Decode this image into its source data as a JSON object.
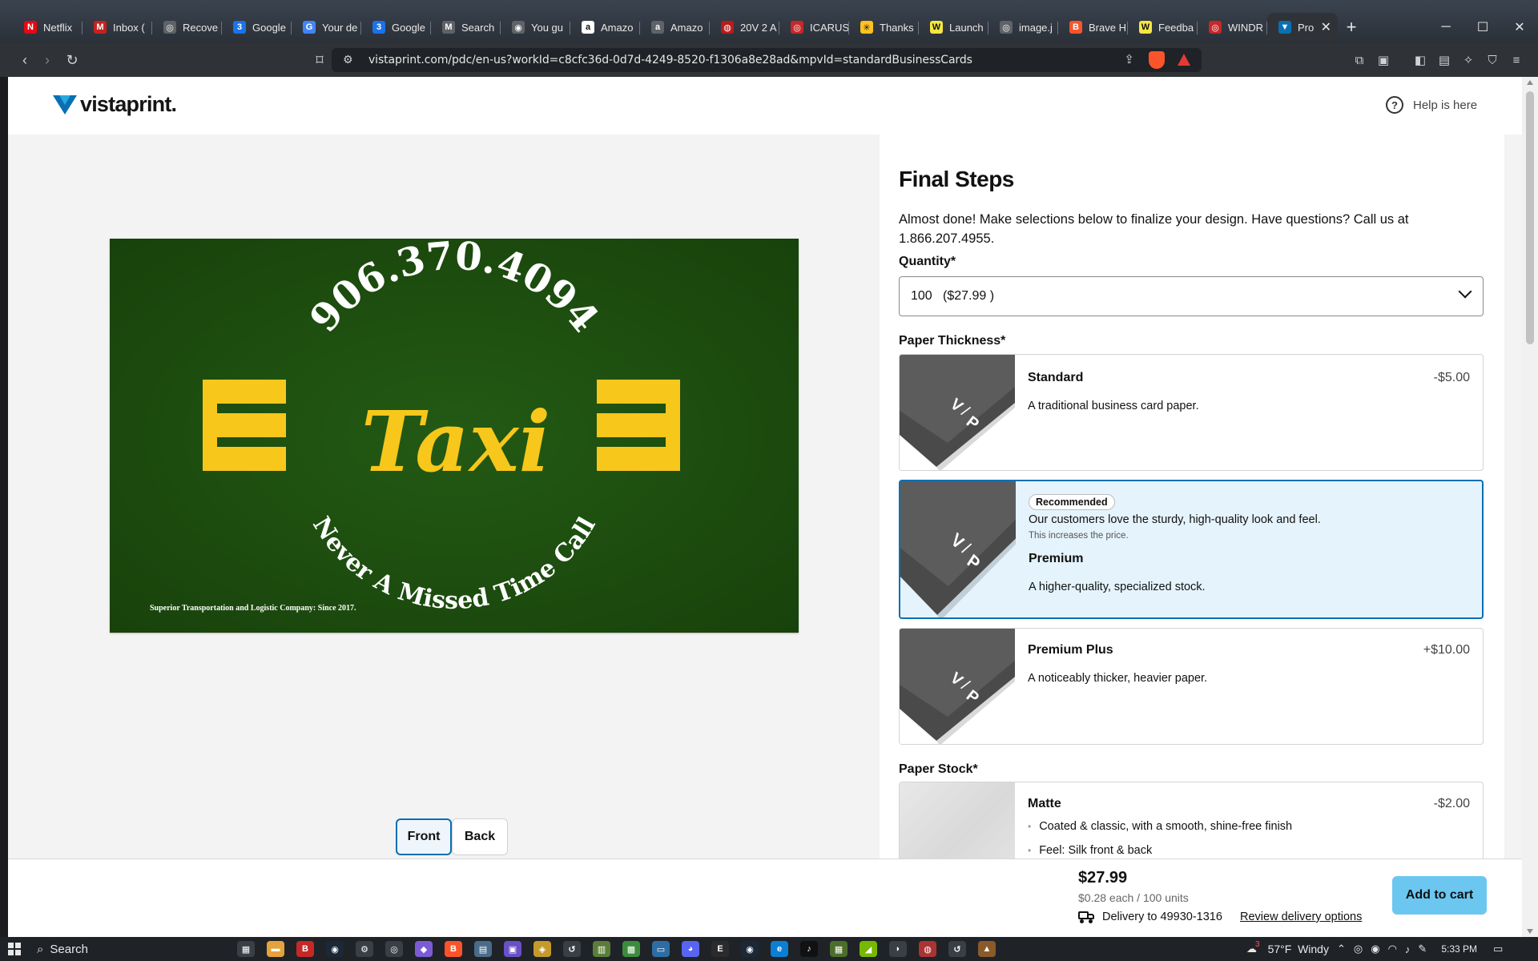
{
  "browser": {
    "tabs": [
      {
        "label": "Netflix",
        "icon": "netflix-icon",
        "color": "#e50914",
        "glyph": "N"
      },
      {
        "label": "Inbox (",
        "icon": "gmail-icon",
        "color": "#c5221f",
        "glyph": "M"
      },
      {
        "label": "Recove",
        "icon": "recovery-icon",
        "color": "#5f6368",
        "glyph": "◎"
      },
      {
        "label": "Google",
        "icon": "google-calendar-icon",
        "color": "#1a73e8",
        "glyph": "3"
      },
      {
        "label": "Your de",
        "icon": "google-icon",
        "color": "#4285f4",
        "glyph": "G"
      },
      {
        "label": "Google",
        "icon": "google-calendar-icon",
        "color": "#1a73e8",
        "glyph": "3"
      },
      {
        "label": "Search",
        "icon": "gmail-search-icon",
        "color": "#5f6368",
        "glyph": "M"
      },
      {
        "label": "You gu",
        "icon": "site-icon",
        "color": "#5f6368",
        "glyph": "◉"
      },
      {
        "label": "Amazo",
        "icon": "amazon-icon",
        "color": "#ffffff",
        "glyph": "a"
      },
      {
        "label": "Amazo",
        "icon": "amazon-icon",
        "color": "#5f6368",
        "glyph": "a"
      },
      {
        "label": "20V 2 A",
        "icon": "hardware-store-icon",
        "color": "#b71c1c",
        "glyph": "◍"
      },
      {
        "label": "ICARUS",
        "icon": "icarus-icon",
        "color": "#c62828",
        "glyph": "◎"
      },
      {
        "label": "Thanks",
        "icon": "walmart-icon",
        "color": "#ffc220",
        "glyph": "✳"
      },
      {
        "label": "Launch",
        "icon": "launch-icon",
        "color": "#f5e642",
        "glyph": "W"
      },
      {
        "label": "image.j",
        "icon": "image-icon",
        "color": "#5f6368",
        "glyph": "◎"
      },
      {
        "label": "Brave H",
        "icon": "brave-icon",
        "color": "#fb542b",
        "glyph": "B"
      },
      {
        "label": "Feedba",
        "icon": "feedback-icon",
        "color": "#f5e642",
        "glyph": "W"
      },
      {
        "label": "WINDR",
        "icon": "windrose-icon",
        "color": "#c62828",
        "glyph": "◎"
      },
      {
        "label": "Pro",
        "icon": "vistaprint-icon",
        "color": "#0a6fb3",
        "glyph": "▼",
        "active": true
      }
    ],
    "url": "vistaprint.com/pdc/en-us?workId=c8cfc36d-0d7d-4249-8520-f1306a8e28ad&mpvId=standardBusinessCards",
    "new_tab": "+"
  },
  "page": {
    "logo": "vistaprint.",
    "help_label": "Help is here",
    "card": {
      "phone": "906.370.4094",
      "brand": "Taxi",
      "slogan": "Never A Missed Time Call",
      "tagline": "Superior Transportation and Logistic Company: Since 2017.",
      "bg_color": "#1c4a0f",
      "accent_color": "#f7c71b"
    },
    "face_buttons": {
      "front": "Front",
      "back": "Back",
      "selected": "Front"
    },
    "steps": {
      "title": "Final Steps",
      "intro": "Almost done! Make selections below to finalize your design. Have questions? Call us at 1.866.207.4955.",
      "quantity_label": "Quantity*",
      "quantity_value": "100   ($27.99 )",
      "thickness_label": "Paper Thickness*",
      "thickness_options": [
        {
          "name": "Standard",
          "price": "-$5.00",
          "desc": "A traditional business card paper."
        },
        {
          "name": "Premium",
          "badge": "Recommended",
          "rec_text": "Our customers love the sturdy, high-quality look and feel.",
          "rec_sub": "This increases the price.",
          "desc": "A higher-quality, specialized stock.",
          "selected": true
        },
        {
          "name": "Premium Plus",
          "price": "+$10.00",
          "desc": "A noticeably thicker, heavier paper."
        }
      ],
      "stock_label": "Paper Stock*",
      "stock_options": [
        {
          "name": "Matte",
          "price": "-$2.00",
          "bullets": [
            "Coated & classic, with a smooth, shine-free finish",
            "Feel: Silk front & back"
          ]
        }
      ]
    },
    "footer": {
      "price": "$27.99",
      "unit": "$0.28 each / 100 units",
      "delivery": "Delivery to 49930-1316",
      "review_link": "Review delivery options",
      "add_to_cart": "Add to cart",
      "cta_color": "#6bc7f0"
    }
  },
  "taskbar": {
    "search_label": "Search",
    "weather": "57°F  Windy",
    "time": "5:33 PM",
    "notification_count": "3"
  }
}
